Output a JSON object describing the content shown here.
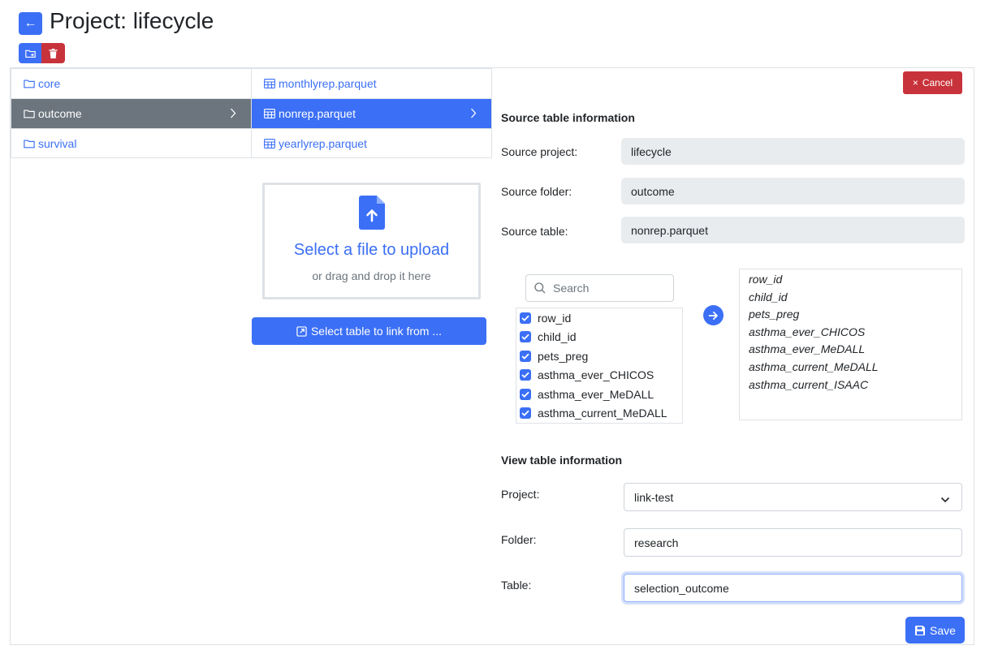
{
  "header": {
    "back_label": "←",
    "title": "Project: lifecycle"
  },
  "folders": [
    {
      "label": "core"
    },
    {
      "label": "outcome"
    },
    {
      "label": "survival"
    }
  ],
  "tables": [
    {
      "label": "monthlyrep.parquet"
    },
    {
      "label": "nonrep.parquet"
    },
    {
      "label": "yearlyrep.parquet"
    }
  ],
  "upload": {
    "title": "Select a file to upload",
    "subtitle": "or drag and drop it here"
  },
  "link_button_label": "Select table to link from ...",
  "cancel_label": "Cancel",
  "source": {
    "heading": "Source table information",
    "project_label": "Source project:",
    "project_value": "lifecycle",
    "folder_label": "Source folder:",
    "folder_value": "outcome",
    "table_label": "Source table:",
    "table_value": "nonrep.parquet"
  },
  "columns": {
    "search_placeholder": "Search",
    "items": [
      {
        "label": "row_id"
      },
      {
        "label": "child_id"
      },
      {
        "label": "pets_preg"
      },
      {
        "label": "asthma_ever_CHICOS"
      },
      {
        "label": "asthma_ever_MeDALL"
      },
      {
        "label": "asthma_current_MeDALL"
      }
    ],
    "selected": [
      "row_id",
      "child_id",
      "pets_preg",
      "asthma_ever_CHICOS",
      "asthma_ever_MeDALL",
      "asthma_current_MeDALL",
      "asthma_current_ISAAC"
    ]
  },
  "view": {
    "heading": "View table information",
    "project_label": "Project:",
    "project_value": "link-test",
    "folder_label": "Folder:",
    "folder_value": "research",
    "table_label": "Table:",
    "table_value": "selection_outcome"
  },
  "save_label": "Save",
  "colors": {
    "primary": "#3b6ff5",
    "danger": "#c8333b",
    "secondary": "#6c757d"
  }
}
